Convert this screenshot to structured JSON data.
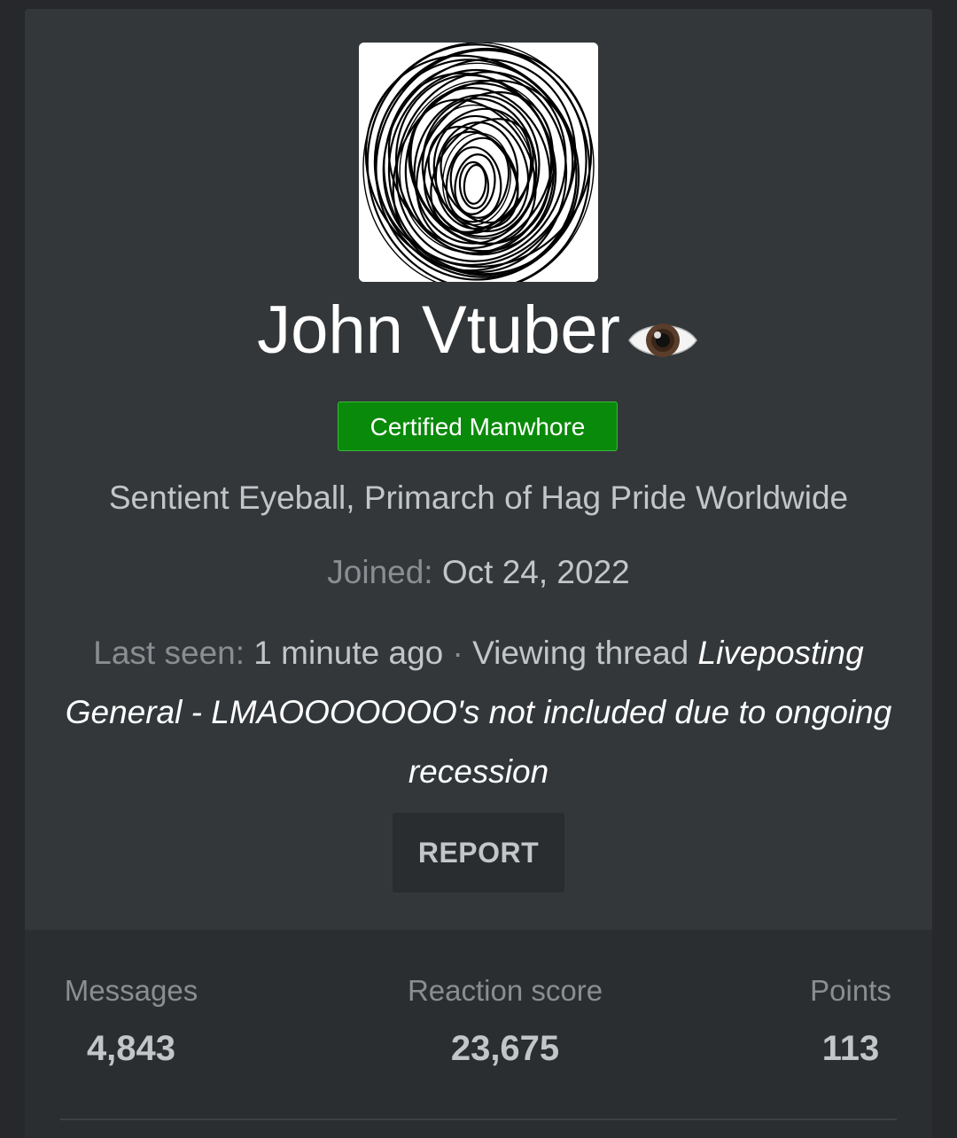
{
  "profile": {
    "username": "John Vtuber",
    "username_emoji": "eye-icon",
    "banner": "Certified Manwhore",
    "banner_color": "#0a8a0a",
    "user_title": "Sentient Eyeball, Primarch of Hag Pride Worldwide",
    "joined_label": "Joined:",
    "joined_value": "Oct 24, 2022",
    "last_seen_label": "Last seen:",
    "last_seen_value": "1 minute ago",
    "activity_separator": " · ",
    "activity_text": "Viewing thread",
    "thread_title": "Liveposting General - LMAOOOOOOO's not included due to ongoing recession",
    "report_label": "REPORT"
  },
  "stats": {
    "messages_label": "Messages",
    "messages_value": "4,843",
    "reaction_label": "Reaction score",
    "reaction_value": "23,675",
    "points_label": "Points",
    "points_value": "113"
  },
  "colors": {
    "page_background": "#26282b",
    "card_background": "#33373a",
    "stats_background": "#2b2e31",
    "accent_green": "#0a8a0a"
  }
}
